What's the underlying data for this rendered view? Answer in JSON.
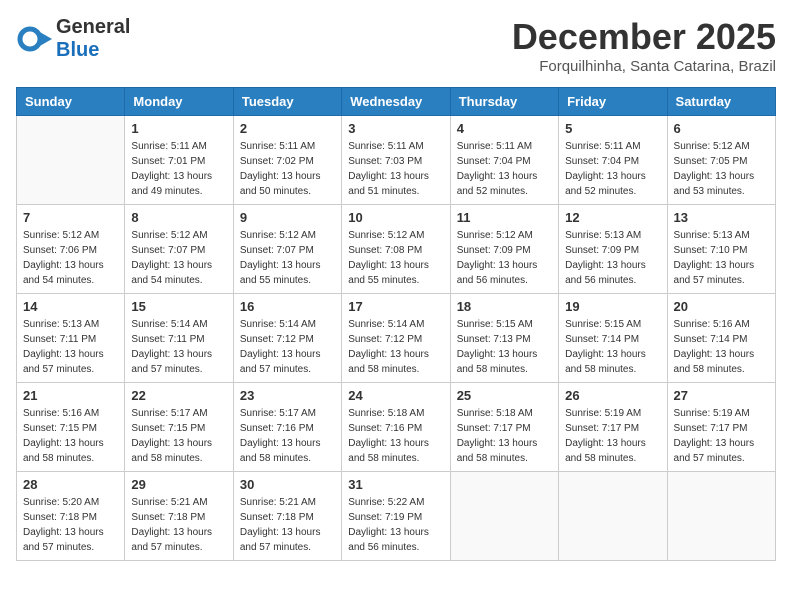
{
  "header": {
    "logo_general": "General",
    "logo_blue": "Blue",
    "month": "December 2025",
    "location": "Forquilhinha, Santa Catarina, Brazil"
  },
  "weekdays": [
    "Sunday",
    "Monday",
    "Tuesday",
    "Wednesday",
    "Thursday",
    "Friday",
    "Saturday"
  ],
  "weeks": [
    [
      {
        "day": "",
        "sunrise": "",
        "sunset": "",
        "daylight": ""
      },
      {
        "day": "1",
        "sunrise": "Sunrise: 5:11 AM",
        "sunset": "Sunset: 7:01 PM",
        "daylight": "Daylight: 13 hours and 49 minutes."
      },
      {
        "day": "2",
        "sunrise": "Sunrise: 5:11 AM",
        "sunset": "Sunset: 7:02 PM",
        "daylight": "Daylight: 13 hours and 50 minutes."
      },
      {
        "day": "3",
        "sunrise": "Sunrise: 5:11 AM",
        "sunset": "Sunset: 7:03 PM",
        "daylight": "Daylight: 13 hours and 51 minutes."
      },
      {
        "day": "4",
        "sunrise": "Sunrise: 5:11 AM",
        "sunset": "Sunset: 7:04 PM",
        "daylight": "Daylight: 13 hours and 52 minutes."
      },
      {
        "day": "5",
        "sunrise": "Sunrise: 5:11 AM",
        "sunset": "Sunset: 7:04 PM",
        "daylight": "Daylight: 13 hours and 52 minutes."
      },
      {
        "day": "6",
        "sunrise": "Sunrise: 5:12 AM",
        "sunset": "Sunset: 7:05 PM",
        "daylight": "Daylight: 13 hours and 53 minutes."
      }
    ],
    [
      {
        "day": "7",
        "sunrise": "Sunrise: 5:12 AM",
        "sunset": "Sunset: 7:06 PM",
        "daylight": "Daylight: 13 hours and 54 minutes."
      },
      {
        "day": "8",
        "sunrise": "Sunrise: 5:12 AM",
        "sunset": "Sunset: 7:07 PM",
        "daylight": "Daylight: 13 hours and 54 minutes."
      },
      {
        "day": "9",
        "sunrise": "Sunrise: 5:12 AM",
        "sunset": "Sunset: 7:07 PM",
        "daylight": "Daylight: 13 hours and 55 minutes."
      },
      {
        "day": "10",
        "sunrise": "Sunrise: 5:12 AM",
        "sunset": "Sunset: 7:08 PM",
        "daylight": "Daylight: 13 hours and 55 minutes."
      },
      {
        "day": "11",
        "sunrise": "Sunrise: 5:12 AM",
        "sunset": "Sunset: 7:09 PM",
        "daylight": "Daylight: 13 hours and 56 minutes."
      },
      {
        "day": "12",
        "sunrise": "Sunrise: 5:13 AM",
        "sunset": "Sunset: 7:09 PM",
        "daylight": "Daylight: 13 hours and 56 minutes."
      },
      {
        "day": "13",
        "sunrise": "Sunrise: 5:13 AM",
        "sunset": "Sunset: 7:10 PM",
        "daylight": "Daylight: 13 hours and 57 minutes."
      }
    ],
    [
      {
        "day": "14",
        "sunrise": "Sunrise: 5:13 AM",
        "sunset": "Sunset: 7:11 PM",
        "daylight": "Daylight: 13 hours and 57 minutes."
      },
      {
        "day": "15",
        "sunrise": "Sunrise: 5:14 AM",
        "sunset": "Sunset: 7:11 PM",
        "daylight": "Daylight: 13 hours and 57 minutes."
      },
      {
        "day": "16",
        "sunrise": "Sunrise: 5:14 AM",
        "sunset": "Sunset: 7:12 PM",
        "daylight": "Daylight: 13 hours and 57 minutes."
      },
      {
        "day": "17",
        "sunrise": "Sunrise: 5:14 AM",
        "sunset": "Sunset: 7:12 PM",
        "daylight": "Daylight: 13 hours and 58 minutes."
      },
      {
        "day": "18",
        "sunrise": "Sunrise: 5:15 AM",
        "sunset": "Sunset: 7:13 PM",
        "daylight": "Daylight: 13 hours and 58 minutes."
      },
      {
        "day": "19",
        "sunrise": "Sunrise: 5:15 AM",
        "sunset": "Sunset: 7:14 PM",
        "daylight": "Daylight: 13 hours and 58 minutes."
      },
      {
        "day": "20",
        "sunrise": "Sunrise: 5:16 AM",
        "sunset": "Sunset: 7:14 PM",
        "daylight": "Daylight: 13 hours and 58 minutes."
      }
    ],
    [
      {
        "day": "21",
        "sunrise": "Sunrise: 5:16 AM",
        "sunset": "Sunset: 7:15 PM",
        "daylight": "Daylight: 13 hours and 58 minutes."
      },
      {
        "day": "22",
        "sunrise": "Sunrise: 5:17 AM",
        "sunset": "Sunset: 7:15 PM",
        "daylight": "Daylight: 13 hours and 58 minutes."
      },
      {
        "day": "23",
        "sunrise": "Sunrise: 5:17 AM",
        "sunset": "Sunset: 7:16 PM",
        "daylight": "Daylight: 13 hours and 58 minutes."
      },
      {
        "day": "24",
        "sunrise": "Sunrise: 5:18 AM",
        "sunset": "Sunset: 7:16 PM",
        "daylight": "Daylight: 13 hours and 58 minutes."
      },
      {
        "day": "25",
        "sunrise": "Sunrise: 5:18 AM",
        "sunset": "Sunset: 7:17 PM",
        "daylight": "Daylight: 13 hours and 58 minutes."
      },
      {
        "day": "26",
        "sunrise": "Sunrise: 5:19 AM",
        "sunset": "Sunset: 7:17 PM",
        "daylight": "Daylight: 13 hours and 58 minutes."
      },
      {
        "day": "27",
        "sunrise": "Sunrise: 5:19 AM",
        "sunset": "Sunset: 7:17 PM",
        "daylight": "Daylight: 13 hours and 57 minutes."
      }
    ],
    [
      {
        "day": "28",
        "sunrise": "Sunrise: 5:20 AM",
        "sunset": "Sunset: 7:18 PM",
        "daylight": "Daylight: 13 hours and 57 minutes."
      },
      {
        "day": "29",
        "sunrise": "Sunrise: 5:21 AM",
        "sunset": "Sunset: 7:18 PM",
        "daylight": "Daylight: 13 hours and 57 minutes."
      },
      {
        "day": "30",
        "sunrise": "Sunrise: 5:21 AM",
        "sunset": "Sunset: 7:18 PM",
        "daylight": "Daylight: 13 hours and 57 minutes."
      },
      {
        "day": "31",
        "sunrise": "Sunrise: 5:22 AM",
        "sunset": "Sunset: 7:19 PM",
        "daylight": "Daylight: 13 hours and 56 minutes."
      },
      {
        "day": "",
        "sunrise": "",
        "sunset": "",
        "daylight": ""
      },
      {
        "day": "",
        "sunrise": "",
        "sunset": "",
        "daylight": ""
      },
      {
        "day": "",
        "sunrise": "",
        "sunset": "",
        "daylight": ""
      }
    ]
  ]
}
